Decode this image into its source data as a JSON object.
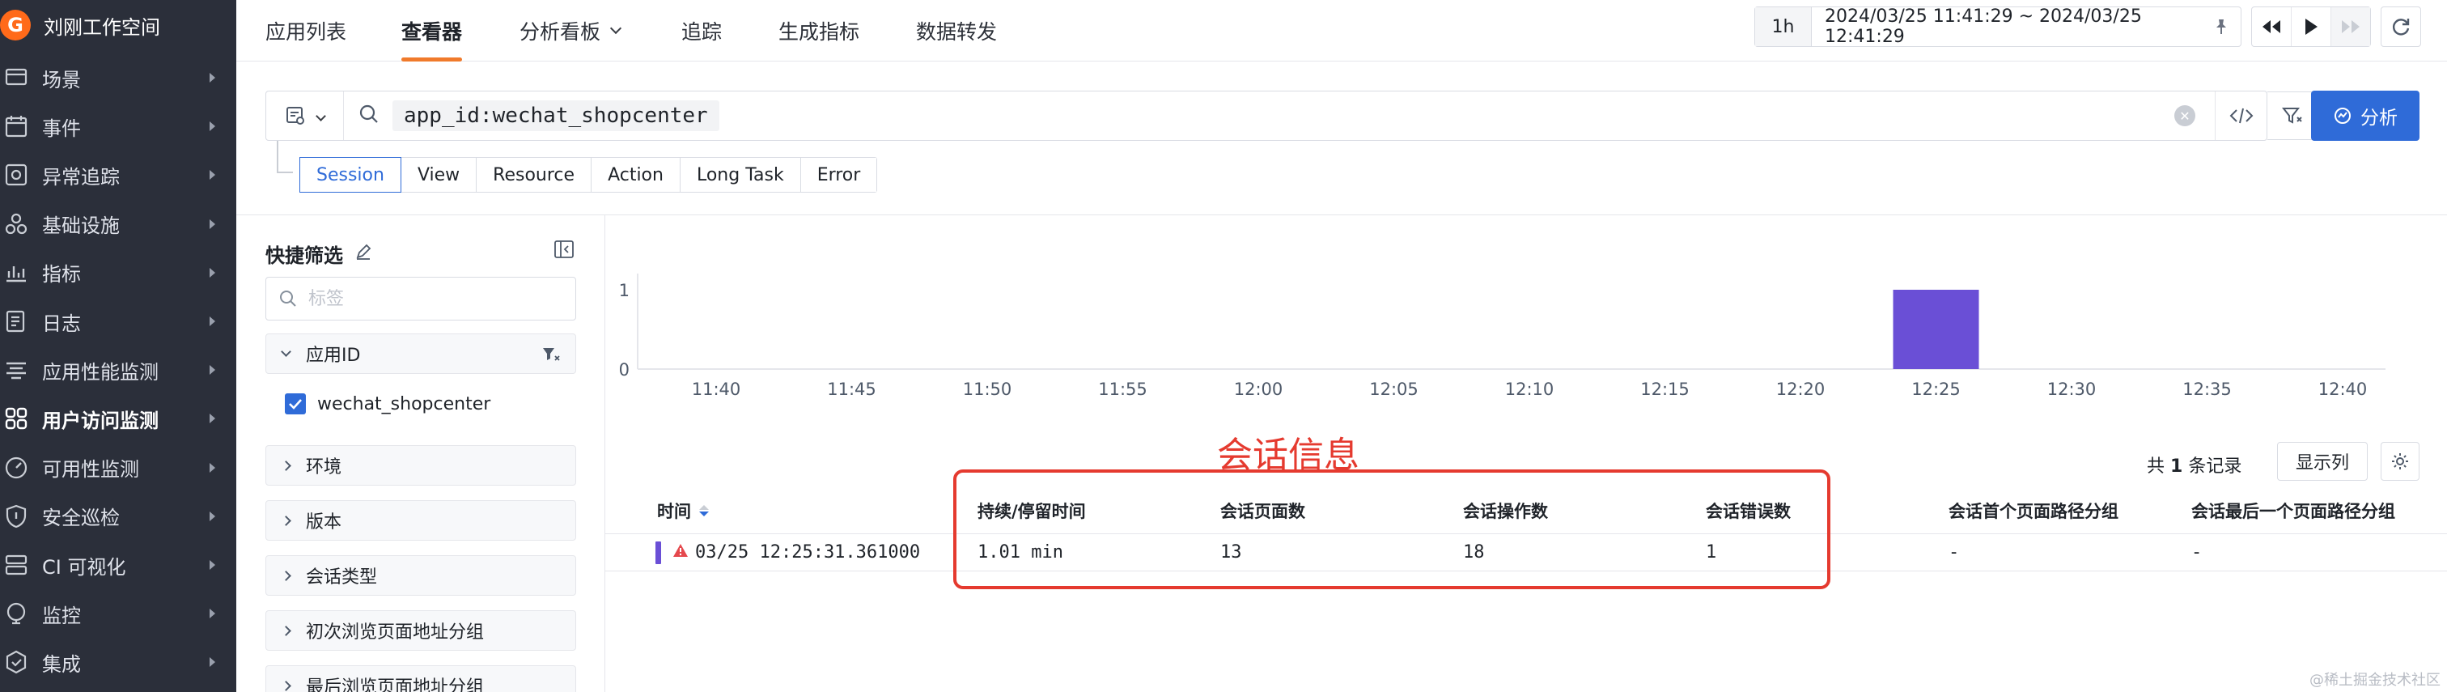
{
  "brand": {
    "name": "刘刚工作空间",
    "logo_letter": "G"
  },
  "sidebar": {
    "items": [
      {
        "label": "场景",
        "icon": "scene-icon"
      },
      {
        "label": "事件",
        "icon": "calendar-icon"
      },
      {
        "label": "异常追踪",
        "icon": "bug-icon"
      },
      {
        "label": "基础设施",
        "icon": "cluster-icon"
      },
      {
        "label": "指标",
        "icon": "metric-icon"
      },
      {
        "label": "日志",
        "icon": "log-icon"
      },
      {
        "label": "应用性能监测",
        "icon": "apm-icon"
      },
      {
        "label": "用户访问监测",
        "icon": "rum-icon",
        "active": true
      },
      {
        "label": "可用性监测",
        "icon": "dial-icon"
      },
      {
        "label": "安全巡检",
        "icon": "shield-icon"
      },
      {
        "label": "CI 可视化",
        "icon": "ci-icon"
      },
      {
        "label": "监控",
        "icon": "monitor-icon"
      },
      {
        "label": "集成",
        "icon": "integration-icon"
      }
    ]
  },
  "topnav": {
    "tabs": [
      {
        "label": "应用列表"
      },
      {
        "label": "查看器",
        "active": true
      },
      {
        "label": "分析看板",
        "dropdown": true
      },
      {
        "label": "追踪"
      },
      {
        "label": "生成指标"
      },
      {
        "label": "数据转发"
      }
    ],
    "range_button": "1h",
    "time_range": "2024/03/25 11:41:29 ~ 2024/03/25 12:41:29"
  },
  "query": {
    "chip": "app_id:wechat_shopcenter",
    "analyze_label": "分析",
    "type_tabs": [
      "Session",
      "View",
      "Resource",
      "Action",
      "Long Task",
      "Error"
    ],
    "active_type": 0
  },
  "filters": {
    "title": "快捷筛选",
    "tag_placeholder": "标签",
    "facets": [
      "应用ID",
      "环境",
      "版本",
      "会话类型",
      "初次浏览页面地址分组",
      "最后浏览页面地址分组"
    ],
    "app_id_value": "wechat_shopcenter"
  },
  "chart_data": {
    "type": "bar",
    "categories": [
      "11:40",
      "11:45",
      "11:50",
      "11:55",
      "12:00",
      "12:05",
      "12:10",
      "12:15",
      "12:20",
      "12:25",
      "12:30",
      "12:35",
      "12:40"
    ],
    "x_ticks": [
      "11:40",
      "11:45",
      "11:50",
      "11:55",
      "12:00",
      "12:05",
      "12:10",
      "12:15",
      "12:20",
      "12:25",
      "12:30",
      "12:35",
      "12:40"
    ],
    "y_ticks": [
      "0",
      "1"
    ],
    "bars": [
      {
        "x": "12:25",
        "value": 1
      }
    ],
    "ylim": [
      0,
      1
    ],
    "bar_color": "#6a4fd6"
  },
  "table": {
    "summary_prefix": "共",
    "summary_count": "1",
    "summary_suffix": "条记录",
    "columns_button": "显示列",
    "headers": [
      "时间",
      "持续/停留时间",
      "会话页面数",
      "会话操作数",
      "会话错误数",
      "会话首个页面路径分组",
      "会话最后一个页面路径分组"
    ],
    "rows": [
      [
        "03/25 12:25:31.361000",
        "1.01 min",
        "13",
        "18",
        "1",
        "-",
        "-"
      ]
    ]
  },
  "annotation": {
    "label": "会话信息",
    "color": "#e53a2f"
  },
  "watermark": "@稀土掘金技术社区"
}
